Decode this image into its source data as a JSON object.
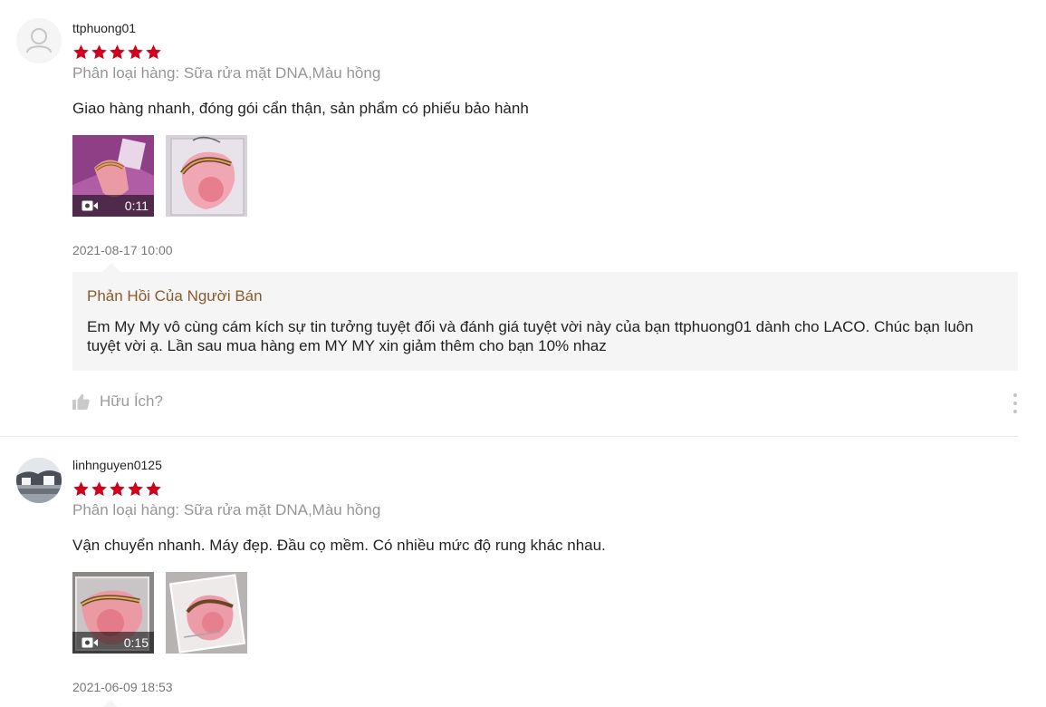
{
  "reviews": [
    {
      "username": "ttphuong01",
      "rating": 5,
      "variation": "Phân loại hàng: Sữa rửa mặt DNA,Màu hồng",
      "content": "Giao hàng nhanh, đóng gói cẩn thận, sản phẩm có phiếu bảo hành",
      "video_duration": "0:11",
      "time": "2021-08-17 10:00",
      "seller_reply": {
        "title": "Phản Hồi Của Người Bán",
        "text": "Em My My vô cùng cám kích sự tin tưởng tuyệt đối và đánh giá tuyệt vời này của bạn ttphuong01 dành cho LACO. Chúc bạn luôn tuyệt vời ạ. Lần sau mua hàng em MY MY xin giảm thêm cho bạn 10% nhaz"
      },
      "helpful_label": "Hữu Ích?"
    },
    {
      "username": "linhnguyen0125",
      "rating": 5,
      "variation": "Phân loại hàng: Sữa rửa mặt DNA,Màu hồng",
      "content": "Vận chuyển nhanh. Máy đẹp. Đầu cọ mềm. Có nhiều mức độ rung khác nhau.",
      "video_duration": "0:15",
      "time": "2021-06-09 18:53"
    }
  ],
  "colors": {
    "star": "#d0011b",
    "reply_title": "#8b5a2b",
    "reply_bg": "#f5f5f5"
  },
  "icons": [
    "user-avatar-icon",
    "star-icon",
    "video-camera-icon",
    "thumbs-up-icon",
    "more-vertical-icon"
  ]
}
